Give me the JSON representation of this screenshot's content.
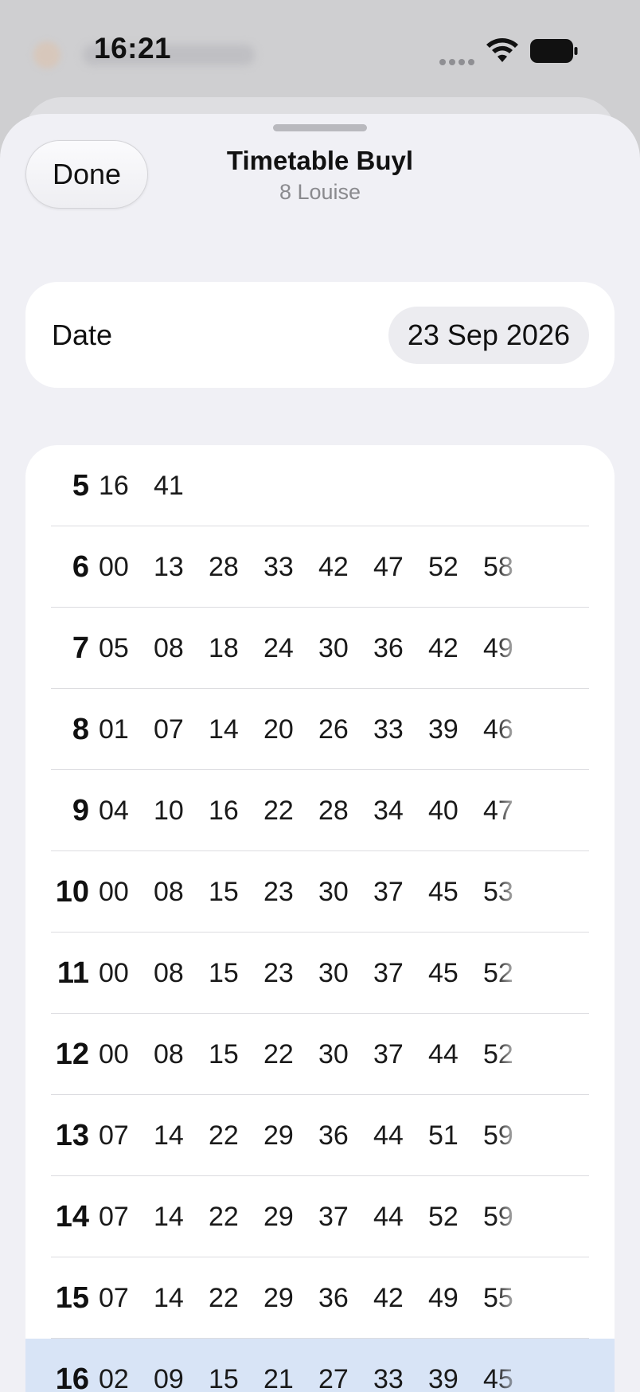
{
  "status_bar": {
    "time": "16:21"
  },
  "header": {
    "done_label": "Done",
    "title": "Timetable Buyl",
    "subtitle": "8 Louise"
  },
  "date_row": {
    "label": "Date",
    "value": "23 Sep 2026"
  },
  "timetable": {
    "rows": [
      {
        "hour": "5",
        "minutes": [
          "16",
          "41"
        ]
      },
      {
        "hour": "6",
        "minutes": [
          "00",
          "13",
          "28",
          "33",
          "42",
          "47",
          "52",
          "58"
        ]
      },
      {
        "hour": "7",
        "minutes": [
          "05",
          "08",
          "18",
          "24",
          "30",
          "36",
          "42",
          "49"
        ]
      },
      {
        "hour": "8",
        "minutes": [
          "01",
          "07",
          "14",
          "20",
          "26",
          "33",
          "39",
          "46"
        ]
      },
      {
        "hour": "9",
        "minutes": [
          "04",
          "10",
          "16",
          "22",
          "28",
          "34",
          "40",
          "47"
        ]
      },
      {
        "hour": "10",
        "minutes": [
          "00",
          "08",
          "15",
          "23",
          "30",
          "37",
          "45",
          "53"
        ]
      },
      {
        "hour": "11",
        "minutes": [
          "00",
          "08",
          "15",
          "23",
          "30",
          "37",
          "45",
          "52"
        ]
      },
      {
        "hour": "12",
        "minutes": [
          "00",
          "08",
          "15",
          "22",
          "30",
          "37",
          "44",
          "52"
        ]
      },
      {
        "hour": "13",
        "minutes": [
          "07",
          "14",
          "22",
          "29",
          "36",
          "44",
          "51",
          "59"
        ]
      },
      {
        "hour": "14",
        "minutes": [
          "07",
          "14",
          "22",
          "29",
          "37",
          "44",
          "52",
          "59"
        ]
      },
      {
        "hour": "15",
        "minutes": [
          "07",
          "14",
          "22",
          "29",
          "36",
          "42",
          "49",
          "55"
        ]
      },
      {
        "hour": "16",
        "minutes": [
          "02",
          "09",
          "15",
          "21",
          "27",
          "33",
          "39",
          "45"
        ],
        "current": true
      }
    ]
  },
  "colors": {
    "sheet_background": "#f0f0f5",
    "card_background": "#ffffff",
    "current_hour_highlight": "#d8e4f6",
    "secondary_text": "#8a8a8e"
  },
  "icons": {
    "wifi": "wifi-icon",
    "battery": "battery-icon",
    "cellular": "cellular-signal-icon"
  }
}
